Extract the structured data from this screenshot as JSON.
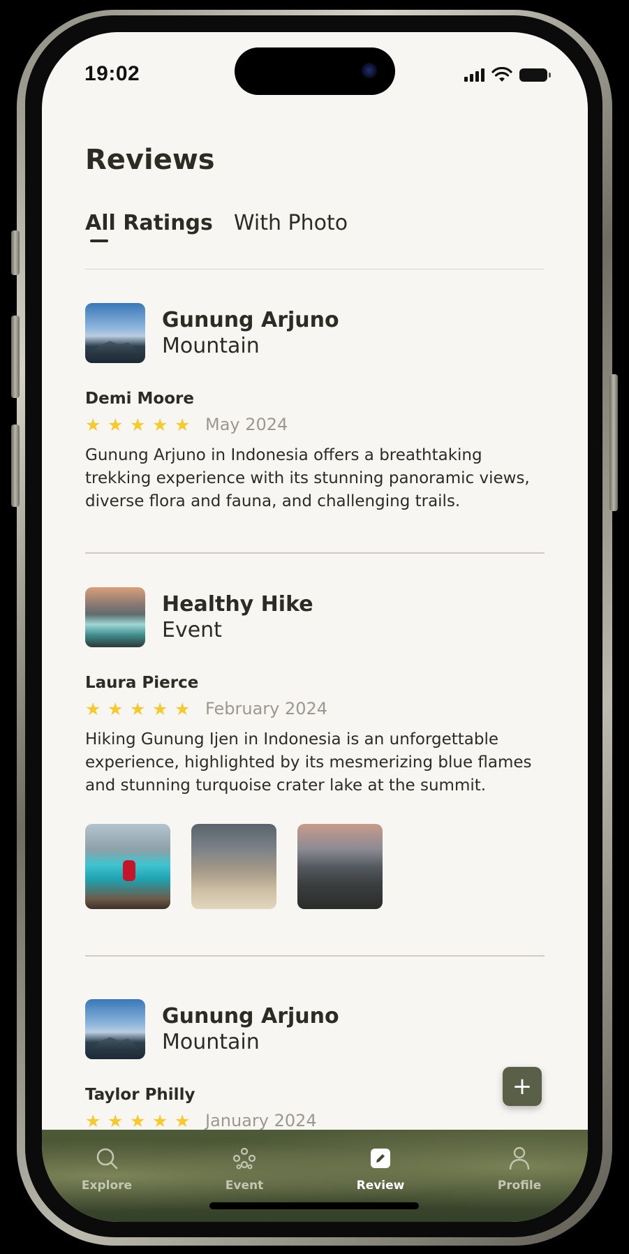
{
  "status_bar": {
    "time": "19:02"
  },
  "page": {
    "title": "Reviews"
  },
  "tabs": [
    {
      "label": "All Ratings",
      "active": true
    },
    {
      "label": "With Photo",
      "active": false
    }
  ],
  "reviews": [
    {
      "place": "Gunung Arjuno",
      "type": "Mountain",
      "thumbnail": "mountain-photo",
      "reviewer": "Demi Moore",
      "rating": 5,
      "date": "May 2024",
      "text": "Gunung Arjuno in Indonesia offers a breathtaking trekking experience with its stunning panoramic views, diverse flora and fauna, and challenging trails."
    },
    {
      "place": "Healthy Hike",
      "type": "Event",
      "thumbnail": "crater-lake-photo",
      "reviewer": "Laura Pierce",
      "rating": 5,
      "date": "February 2024",
      "text": "Hiking Gunung Ijen in Indonesia is an unforgettable experience, highlighted by its mesmerizing blue flames and stunning turquoise crater lake at the summit.",
      "photos": [
        "crater-lake-hiker-photo",
        "hikers-trail-photo",
        "summit-camp-photo"
      ]
    },
    {
      "place": "Gunung Arjuno",
      "type": "Mountain",
      "thumbnail": "mountain-photo",
      "reviewer": "Taylor Philly",
      "rating": 5,
      "date": "January 2024"
    }
  ],
  "fab": {
    "icon": "plus-icon",
    "label": "+"
  },
  "bottom_nav": [
    {
      "label": "Explore",
      "icon": "search-icon",
      "active": false
    },
    {
      "label": "Event",
      "icon": "group-icon",
      "active": false
    },
    {
      "label": "Review",
      "icon": "edit-icon",
      "active": true
    },
    {
      "label": "Profile",
      "icon": "user-icon",
      "active": false
    }
  ],
  "colors": {
    "background": "#f8f6f3",
    "text": "#2c2c25",
    "star": "#f7c930",
    "muted": "#9b9890",
    "accent": "#5a5f47",
    "nav": "#3e4a2f"
  }
}
